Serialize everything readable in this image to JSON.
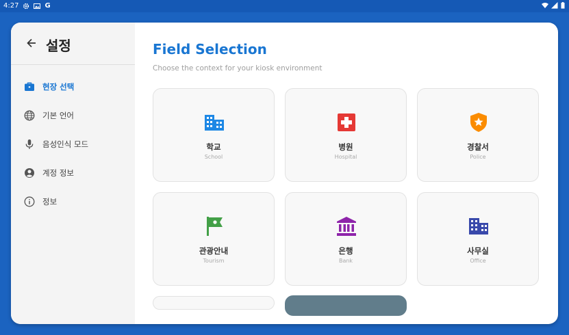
{
  "status_bar": {
    "time": "4:27",
    "g_label": "G"
  },
  "sidebar": {
    "title": "설정",
    "items": [
      {
        "label": "현장 선택",
        "icon": "briefcase-icon",
        "active": true
      },
      {
        "label": "기본 언어",
        "icon": "globe-icon"
      },
      {
        "label": "음성인식 모드",
        "icon": "microphone-icon"
      },
      {
        "label": "계정 정보",
        "icon": "account-circle-icon"
      },
      {
        "label": "정보",
        "icon": "info-icon"
      }
    ]
  },
  "main": {
    "title": "Field Selection",
    "subtitle": "Choose the context for your kiosk environment",
    "fields": [
      {
        "name": "학교",
        "en": "School",
        "icon": "school-building-icon",
        "color": "#1e88e5"
      },
      {
        "name": "병원",
        "en": "Hospital",
        "icon": "hospital-cross-icon",
        "color": "#e53935"
      },
      {
        "name": "경찰서",
        "en": "Police",
        "icon": "police-badge-icon",
        "color": "#fb8c00"
      },
      {
        "name": "관광안내",
        "en": "Tourism",
        "icon": "flag-icon",
        "color": "#43a047"
      },
      {
        "name": "은행",
        "en": "Bank",
        "icon": "bank-icon",
        "color": "#8e24aa"
      },
      {
        "name": "사무실",
        "en": "Office",
        "icon": "office-building-icon",
        "color": "#3949ab"
      }
    ]
  },
  "colors": {
    "accent": "#1976d2",
    "background": "#1b63c0"
  }
}
